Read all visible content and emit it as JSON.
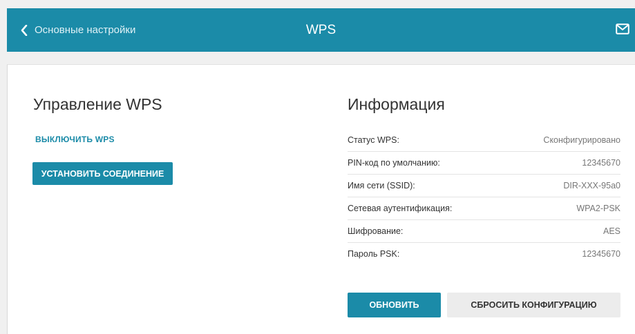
{
  "header": {
    "back_label": "Основные настройки",
    "title": "WPS",
    "back_icon": "chevron-left-icon",
    "mail_icon": "envelope-icon",
    "color": "#1b8ba8"
  },
  "wps_control": {
    "title": "Управление WPS",
    "disable_label": "ВЫКЛЮЧИТЬ WPS",
    "connect_label": "УСТАНОВИТЬ СОЕДИНЕНИЕ"
  },
  "info": {
    "title": "Информация",
    "rows": [
      {
        "label": "Статус WPS:",
        "value": "Сконфигурировано"
      },
      {
        "label": "PIN-код по умолчанию:",
        "value": "12345670"
      },
      {
        "label": "Имя сети (SSID):",
        "value": "DIR-XXX-95a0"
      },
      {
        "label": "Сетевая аутентификация:",
        "value": "WPA2-PSK"
      },
      {
        "label": "Шифрование:",
        "value": "AES"
      },
      {
        "label": "Пароль PSK:",
        "value": "12345670"
      }
    ],
    "refresh_label": "ОБНОВИТЬ",
    "reset_label": "СБРОСИТЬ КОНФИГУРАЦИЮ"
  }
}
